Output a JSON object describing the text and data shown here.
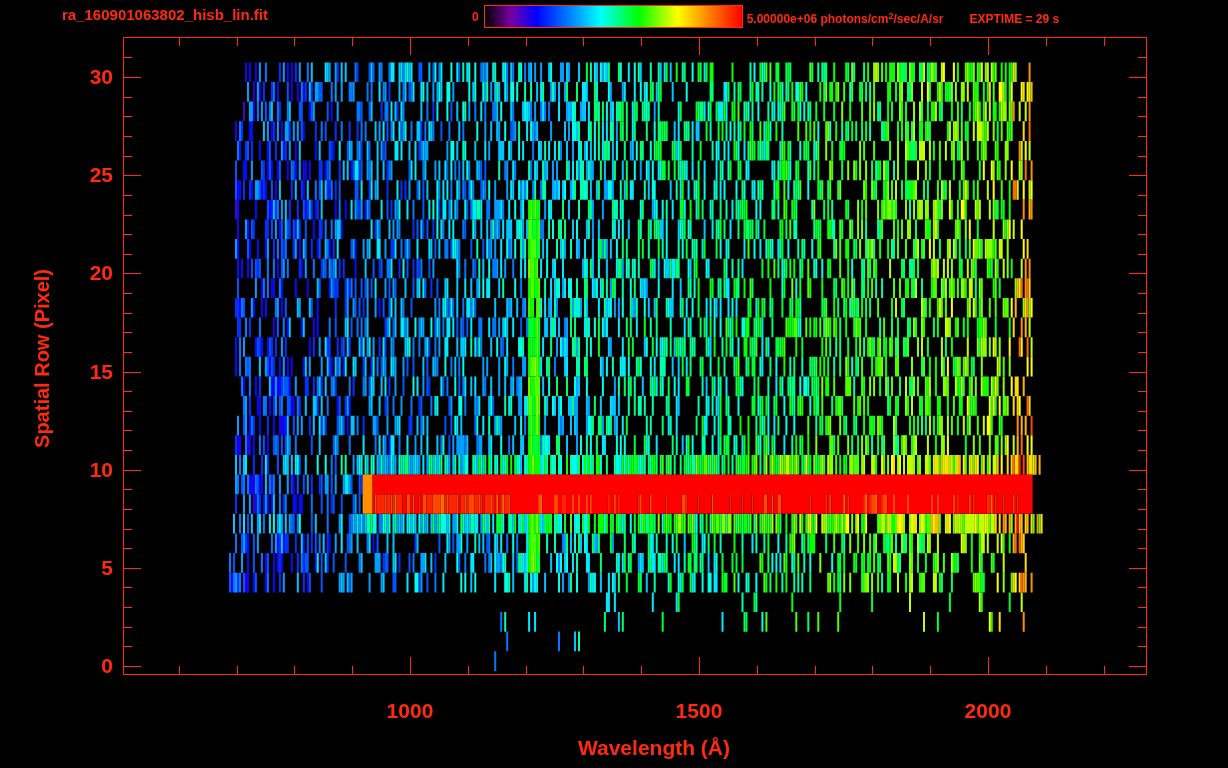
{
  "title": "ra_160901063802_hisb_lin.fit",
  "colorbar": {
    "min_label": "0",
    "max_label": "5.00000e+06 photons/cm$^{2}$/sec/A/sr"
  },
  "exptime": "EXPTIME = 29 s",
  "plot": {
    "ylabel": "Spatial Row (Pixel)",
    "xlabel": "Wavelength (Å)",
    "yticks": [
      "30",
      "25",
      "20",
      "15",
      "10",
      "5",
      "0"
    ],
    "xticks": [
      "1000",
      "1500",
      "2000"
    ]
  }
}
